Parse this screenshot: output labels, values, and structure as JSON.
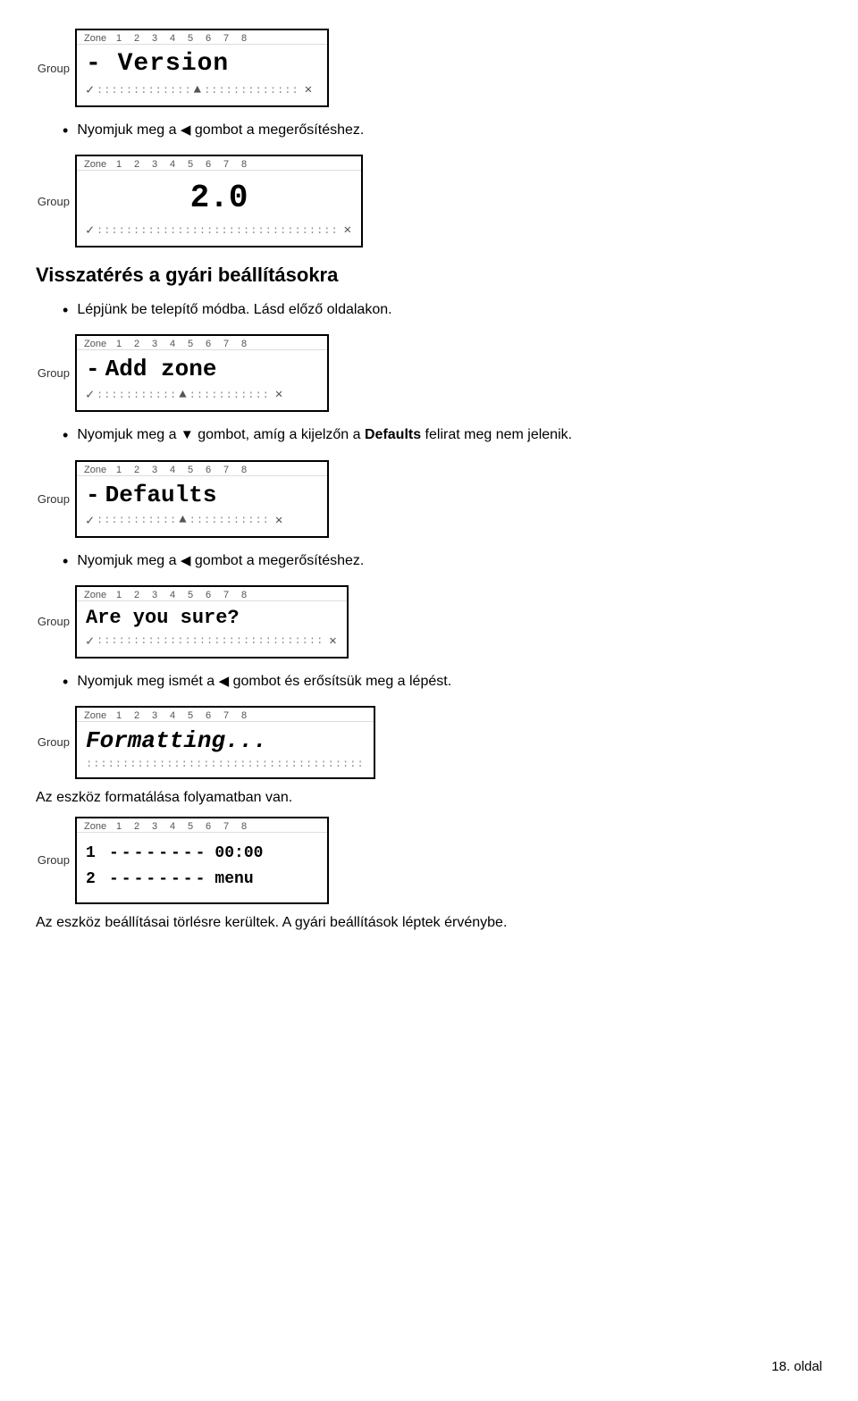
{
  "page": {
    "number": "18. oldal"
  },
  "displays": [
    {
      "id": "display-version",
      "zone_label": "Zone",
      "zone_numbers": [
        "1",
        "2",
        "3",
        "4",
        "5",
        "6",
        "7",
        "8"
      ],
      "group_label": "Group",
      "row1": "- Version",
      "row2_dots_left": ":::::::::::::",
      "row2_up": "▲",
      "row2_dots_right": ":::::::::::::",
      "row2_x": "✕"
    },
    {
      "id": "display-2-0",
      "zone_label": "Zone",
      "zone_numbers": [
        "1",
        "2",
        "3",
        "4",
        "5",
        "6",
        "7",
        "8"
      ],
      "group_label": "Group",
      "row1": "2.0",
      "row2_check": "✓",
      "row2_dots": ":::::::::::::::::::::::::::::::::",
      "row2_x": "✕"
    },
    {
      "id": "display-add-zone",
      "zone_label": "Zone",
      "zone_numbers": [
        "1",
        "2",
        "3",
        "4",
        "5",
        "6",
        "7",
        "8"
      ],
      "group_label": "Group",
      "row1_minus": "-",
      "row1_text": "Add zone",
      "row2_check": "✓",
      "row2_dots_left": ":::::::::::",
      "row2_up": "▲",
      "row2_dots_right": ":::::::::::",
      "row2_x": "✕"
    },
    {
      "id": "display-defaults",
      "zone_label": "Zone",
      "zone_numbers": [
        "1",
        "2",
        "3",
        "4",
        "5",
        "6",
        "7",
        "8"
      ],
      "group_label": "Group",
      "row1_minus": "-",
      "row1_text": "Defaults",
      "row2_check": "✓",
      "row2_dots_left": ":::::::::::",
      "row2_up": "▲",
      "row2_dots_right": ":::::::::::",
      "row2_x": "✕"
    },
    {
      "id": "display-are-you-sure",
      "zone_label": "Zone",
      "zone_numbers": [
        "1",
        "2",
        "3",
        "4",
        "5",
        "6",
        "7",
        "8"
      ],
      "group_label": "Group",
      "row1": "Are you sure?",
      "row2_check": "✓",
      "row2_dots": ":::::::::::::::::::::::::::::::",
      "row2_x": "✕"
    },
    {
      "id": "display-formatting",
      "zone_label": "Zone",
      "zone_numbers": [
        "1",
        "2",
        "3",
        "4",
        "5",
        "6",
        "7",
        "8"
      ],
      "group_label": "Group",
      "row1": "Formatting...",
      "row2_dots": "::::::::::::::::::::::::::::::::::::"
    },
    {
      "id": "display-table",
      "zone_label": "Zone",
      "zone_numbers": [
        "1",
        "2",
        "3",
        "4",
        "5",
        "6",
        "7",
        "8"
      ],
      "group_label": "Group",
      "rows": [
        {
          "num": "1",
          "dashes": "--------",
          "value": "00:00"
        },
        {
          "num": "2",
          "dashes": "--------",
          "value": "menu"
        }
      ]
    }
  ],
  "bullets": [
    {
      "id": "bullet-1",
      "text": "Nyomjuk meg a ",
      "icon": "◀",
      "text2": " gombot a megerősítéshez."
    },
    {
      "id": "bullet-visszateres-title",
      "is_title": true,
      "text": "Visszatérés a gyári beállításokra"
    },
    {
      "id": "bullet-2",
      "text": "Lépjünk be telepítő módba. Lásd előző oldalakon."
    },
    {
      "id": "bullet-3",
      "text": "Nyomjuk meg a ",
      "icon": "▼",
      "text2": " gombot, amíg a kijelzőn a ",
      "bold": "Defaults",
      "text3": " felirat meg nem jelenik."
    },
    {
      "id": "bullet-4",
      "text": "Nyomjuk meg a ",
      "icon": "◀",
      "text2": " gombot a megerősítéshez."
    },
    {
      "id": "bullet-5",
      "text": "Nyomjuk meg ismét a ",
      "icon": "◀",
      "text2": " gombot és erősítsük meg a lépést."
    },
    {
      "id": "bullet-6-caption",
      "text": "Az eszköz formatálása folyamatban van."
    },
    {
      "id": "bullet-7-caption",
      "text": "Az eszköz beállításai törlésre kerültek. A gyári beállítások léptek érvénybe."
    }
  ]
}
